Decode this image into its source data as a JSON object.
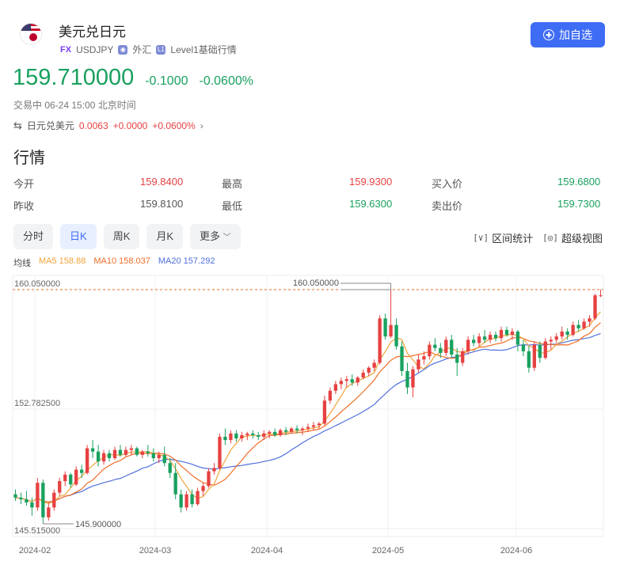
{
  "header": {
    "title": "美元兑日元",
    "fx_badge": "FX",
    "code": "USDJPY",
    "market": "外汇",
    "level": "Level1基础行情",
    "add_button": "加自选",
    "flag_icon": "us-jp-flag"
  },
  "price": {
    "last": "159.710000",
    "change": "-0.1000",
    "change_pct": "-0.0600%",
    "color": "#19a15f"
  },
  "status": "交易中 06-24 15:00 北京时间",
  "related": {
    "name": "日元兑美元",
    "price": "0.0063",
    "change": "+0.0000",
    "change_pct": "+0.0600%"
  },
  "section_title": "行情",
  "quote": {
    "open_label": "今开",
    "open": "159.8400",
    "high_label": "最高",
    "high": "159.9300",
    "bid_label": "买入价",
    "bid": "159.6800",
    "prev_label": "昨收",
    "prev": "159.8100",
    "low_label": "最低",
    "low": "159.6300",
    "ask_label": "卖出价",
    "ask": "159.7300"
  },
  "tabs": [
    {
      "label": "分时",
      "active": false
    },
    {
      "label": "日K",
      "active": true
    },
    {
      "label": "周K",
      "active": false
    },
    {
      "label": "月K",
      "active": false
    },
    {
      "label": "更多",
      "active": false
    }
  ],
  "tools": {
    "range_stats": "区间统计",
    "super_view": "超级视图"
  },
  "ma": {
    "label": "均线",
    "ma5": "MA5 158.88",
    "ma10": "MA10 158.037",
    "ma20": "MA20 157.292"
  },
  "colors": {
    "up": "#e64141",
    "down": "#19a15f",
    "accent": "#3f6cf4",
    "ma5": "#f0a33a",
    "ma10": "#f06d27",
    "ma20": "#4f6fdc"
  },
  "chart_data": {
    "type": "candlestick",
    "y_ticks": [
      "160.050000",
      "152.782500",
      "145.515000"
    ],
    "ylim": [
      145.515,
      160.05
    ],
    "x_ticks": [
      "2024-02",
      "2024-03",
      "2024-04",
      "2024-05",
      "2024-06"
    ],
    "annotations": {
      "max_label": "160.050000",
      "min_label": "145.900000",
      "last_price_line": 160.05
    },
    "candles": [
      [
        147.6,
        147.9,
        147.2,
        147.4
      ],
      [
        147.4,
        147.7,
        147.0,
        147.3
      ],
      [
        147.3,
        147.8,
        146.9,
        147.1
      ],
      [
        147.1,
        147.4,
        146.3,
        146.8
      ],
      [
        146.8,
        148.6,
        146.6,
        148.3
      ],
      [
        148.3,
        148.5,
        145.9,
        146.2
      ],
      [
        146.2,
        147.1,
        146.0,
        146.8
      ],
      [
        146.8,
        147.9,
        146.6,
        147.7
      ],
      [
        147.7,
        148.6,
        147.5,
        148.4
      ],
      [
        148.4,
        149.0,
        148.1,
        148.8
      ],
      [
        148.8,
        148.9,
        148.0,
        148.2
      ],
      [
        148.2,
        149.3,
        148.1,
        149.1
      ],
      [
        149.1,
        149.4,
        148.6,
        148.9
      ],
      [
        148.9,
        150.6,
        148.8,
        150.4
      ],
      [
        150.4,
        150.9,
        149.8,
        150.2
      ],
      [
        150.2,
        150.6,
        149.3,
        149.6
      ],
      [
        149.6,
        150.3,
        149.4,
        150.1
      ],
      [
        150.1,
        150.3,
        149.6,
        149.8
      ],
      [
        149.8,
        150.5,
        149.7,
        150.3
      ],
      [
        150.3,
        150.6,
        149.9,
        150.0
      ],
      [
        150.0,
        150.5,
        149.9,
        150.3
      ],
      [
        150.3,
        150.6,
        150.0,
        150.4
      ],
      [
        150.4,
        150.5,
        149.9,
        150.0
      ],
      [
        150.0,
        150.3,
        149.8,
        150.2
      ],
      [
        150.2,
        150.6,
        149.9,
        150.1
      ],
      [
        150.1,
        150.4,
        149.6,
        149.8
      ],
      [
        149.8,
        150.2,
        149.5,
        150.0
      ],
      [
        150.0,
        150.5,
        149.3,
        149.5
      ],
      [
        149.5,
        149.8,
        148.6,
        148.9
      ],
      [
        148.9,
        149.5,
        147.3,
        147.6
      ],
      [
        147.6,
        147.9,
        146.5,
        146.8
      ],
      [
        146.8,
        147.8,
        146.6,
        147.6
      ],
      [
        147.6,
        147.9,
        146.8,
        147.0
      ],
      [
        147.0,
        148.0,
        146.9,
        147.8
      ],
      [
        147.8,
        148.3,
        147.5,
        148.1
      ],
      [
        148.1,
        149.2,
        148.0,
        149.0
      ],
      [
        149.0,
        149.5,
        148.8,
        149.2
      ],
      [
        149.2,
        151.3,
        149.1,
        151.1
      ],
      [
        151.1,
        151.6,
        150.6,
        150.9
      ],
      [
        150.9,
        151.5,
        150.7,
        151.3
      ],
      [
        151.3,
        151.5,
        150.8,
        151.0
      ],
      [
        151.0,
        151.4,
        150.8,
        151.2
      ],
      [
        151.2,
        151.4,
        150.9,
        151.3
      ],
      [
        151.3,
        151.5,
        151.0,
        151.2
      ],
      [
        151.2,
        151.4,
        150.9,
        151.1
      ],
      [
        151.1,
        151.5,
        150.9,
        151.3
      ],
      [
        151.3,
        151.5,
        151.0,
        151.4
      ],
      [
        151.4,
        151.6,
        151.1,
        151.2
      ],
      [
        151.2,
        151.6,
        151.1,
        151.5
      ],
      [
        151.5,
        151.7,
        151.2,
        151.4
      ],
      [
        151.4,
        151.7,
        151.3,
        151.6
      ],
      [
        151.6,
        151.8,
        151.3,
        151.5
      ],
      [
        151.5,
        151.7,
        151.2,
        151.6
      ],
      [
        151.6,
        151.9,
        151.4,
        151.7
      ],
      [
        151.7,
        152.0,
        151.5,
        151.8
      ],
      [
        151.8,
        152.0,
        151.6,
        151.9
      ],
      [
        151.9,
        153.6,
        151.8,
        153.3
      ],
      [
        153.3,
        154.1,
        153.1,
        153.9
      ],
      [
        153.9,
        154.5,
        153.7,
        154.3
      ],
      [
        154.3,
        154.7,
        154.0,
        154.5
      ],
      [
        154.5,
        154.8,
        154.1,
        154.6
      ],
      [
        154.6,
        154.9,
        154.2,
        154.4
      ],
      [
        154.4,
        154.8,
        154.2,
        154.7
      ],
      [
        154.7,
        155.2,
        154.6,
        155.0
      ],
      [
        155.0,
        155.4,
        154.8,
        155.3
      ],
      [
        155.3,
        155.8,
        155.1,
        155.6
      ],
      [
        155.6,
        158.5,
        155.5,
        158.3
      ],
      [
        158.3,
        158.6,
        157.0,
        157.2
      ],
      [
        157.2,
        160.05,
        157.1,
        157.9
      ],
      [
        157.9,
        158.3,
        156.4,
        156.6
      ],
      [
        156.6,
        156.9,
        154.8,
        155.1
      ],
      [
        155.1,
        155.6,
        153.7,
        154.1
      ],
      [
        154.1,
        155.4,
        153.5,
        155.2
      ],
      [
        155.2,
        156.1,
        155.0,
        155.8
      ],
      [
        155.8,
        156.3,
        155.5,
        156.0
      ],
      [
        156.0,
        156.9,
        155.8,
        156.7
      ],
      [
        156.7,
        157.1,
        156.3,
        156.5
      ],
      [
        156.5,
        156.8,
        155.9,
        156.2
      ],
      [
        156.2,
        157.2,
        156.0,
        157.0
      ],
      [
        157.0,
        157.3,
        155.9,
        156.1
      ],
      [
        156.1,
        156.5,
        154.8,
        155.6
      ],
      [
        155.6,
        156.5,
        155.4,
        156.3
      ],
      [
        156.3,
        157.2,
        156.1,
        157.0
      ],
      [
        157.0,
        157.3,
        156.6,
        156.8
      ],
      [
        156.8,
        157.4,
        156.6,
        157.2
      ],
      [
        157.2,
        157.6,
        156.8,
        157.0
      ],
      [
        157.0,
        157.5,
        156.8,
        157.3
      ],
      [
        157.3,
        157.5,
        156.9,
        157.1
      ],
      [
        157.1,
        157.8,
        156.9,
        157.6
      ],
      [
        157.6,
        157.8,
        157.2,
        157.3
      ],
      [
        157.3,
        157.7,
        157.0,
        157.5
      ],
      [
        157.5,
        157.6,
        156.3,
        156.7
      ],
      [
        156.7,
        157.0,
        156.0,
        156.3
      ],
      [
        156.3,
        156.6,
        155.0,
        155.3
      ],
      [
        155.3,
        156.9,
        155.1,
        156.7
      ],
      [
        156.7,
        156.9,
        155.6,
        155.9
      ],
      [
        155.9,
        157.1,
        155.8,
        156.9
      ],
      [
        156.9,
        157.2,
        156.4,
        157.0
      ],
      [
        157.0,
        157.4,
        156.8,
        157.2
      ],
      [
        157.2,
        157.8,
        157.0,
        157.5
      ],
      [
        157.5,
        157.7,
        157.0,
        157.3
      ],
      [
        157.3,
        158.1,
        157.2,
        157.9
      ],
      [
        157.9,
        158.2,
        157.5,
        157.7
      ],
      [
        157.7,
        158.3,
        157.6,
        158.1
      ],
      [
        158.1,
        158.5,
        157.8,
        158.3
      ],
      [
        158.3,
        159.8,
        158.2,
        159.7
      ],
      [
        159.7,
        160.05,
        159.6,
        159.7
      ]
    ]
  }
}
